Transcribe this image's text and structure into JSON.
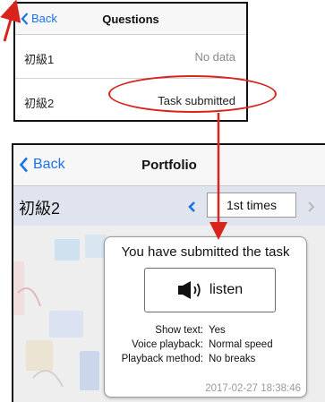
{
  "questions_screen": {
    "back_label": "Back",
    "title": "Questions",
    "rows": [
      {
        "name": "初級1",
        "status": "No data"
      },
      {
        "name": "初級2",
        "status": "Task submitted"
      }
    ]
  },
  "portfolio_screen": {
    "back_label": "Back",
    "title": "Portfolio",
    "sub_header": {
      "name": "初級2",
      "prev_label": "<",
      "times_value": "1st times",
      "next_label": ">"
    },
    "card": {
      "title": "You have submitted the task",
      "listen_label": "listen",
      "listen_icon": "speaker-icon",
      "settings": [
        {
          "label": "Show text:",
          "value": "Yes"
        },
        {
          "label": "Voice playback:",
          "value": "Normal speed"
        },
        {
          "label": "Playback method:",
          "value": "No breaks"
        }
      ],
      "date": "2017-02-27 18:38:46"
    }
  },
  "colors": {
    "accent_blue": "#1a73e8",
    "annotation_red": "#d9231d",
    "sub_header_bg": "#dfe4ef"
  }
}
